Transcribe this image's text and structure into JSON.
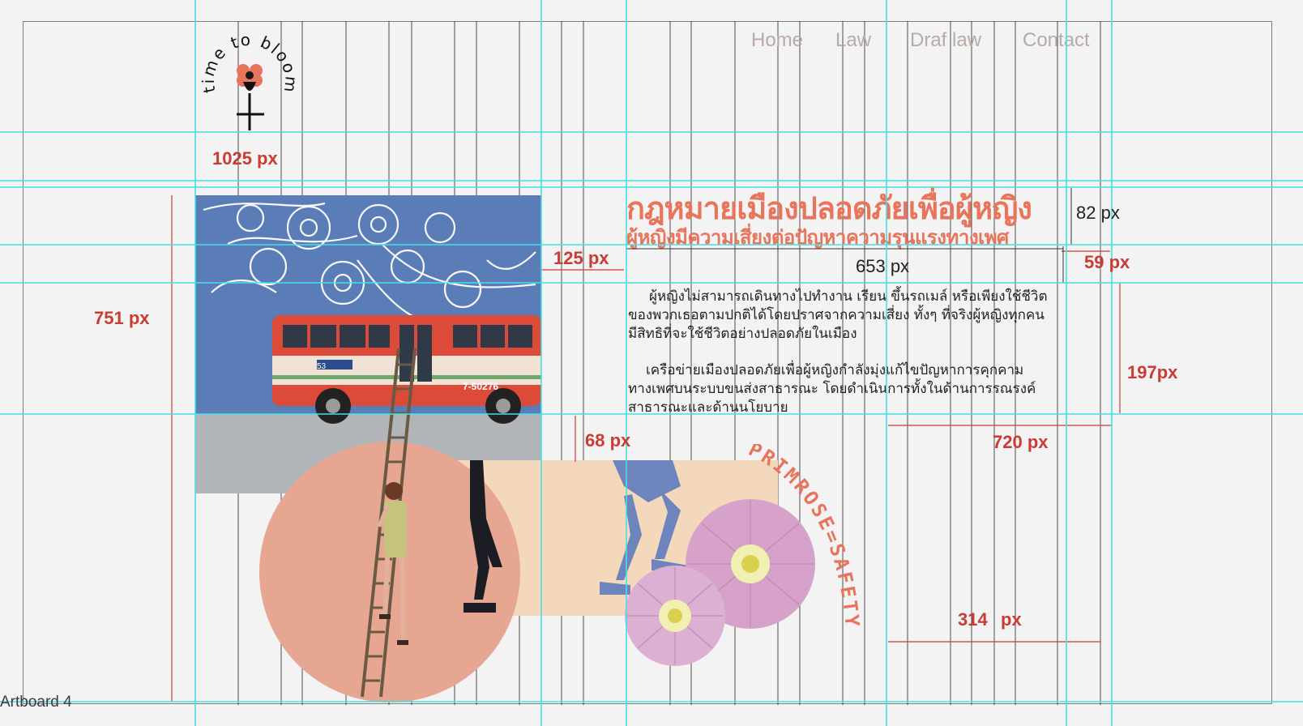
{
  "artboard": {
    "label": "Artboard 4"
  },
  "nav": {
    "items": [
      {
        "label": "Home"
      },
      {
        "label": "Law"
      },
      {
        "label": "Draf law"
      },
      {
        "label": "Contact"
      }
    ]
  },
  "logo": {
    "text": "time to bloom"
  },
  "content": {
    "title": "กฎหมายเมืองปลอดภัยเพื่อผู้หญิง",
    "subtitle": "ผู้หญิงมีความเสี่ยงต่อปัญหาความรุนแรงทางเพศ",
    "paragraph1": [
      "ผู้หญิงไม่สามารถเดินทางไปทำงาน เรียน ขึ้นรถเมล์ หรือเพียงใช้ชีวิต",
      "ของพวกเธอตามปกติได้โดยปราศจากความเสี่ยง ทั้งๆ ที่จริงผู้หญิงทุกคน",
      "มีสิทธิที่จะใช้ชีวิตอย่างปลอดภัยในเมือง"
    ],
    "paragraph2": [
      "เครือข่ายเมืองปลอดภัยเพื่อผู้หญิงกำลังมุ่งแก้ไขปัญหาการคุกคาม",
      "ทางเพศบนระบบขนส่งสาธารณะ โดยดำเนินการทั้งในด้านการรณรงค์",
      "สาธารณะและด้านนโยบาย"
    ]
  },
  "measurements": {
    "m1025": "1025 px",
    "m751": "751 px",
    "m125": "125 px",
    "m653": "653 px",
    "m82": "82 px",
    "m59": "59 px",
    "m197": "197px",
    "m68": "68 px",
    "m720": "720 px",
    "m314": "314",
    "m314unit": "px"
  },
  "art": {
    "primrose_text": "PRIMROSE=SAFETY",
    "bus_number": "53",
    "bus_plate": "7-50276"
  },
  "colors": {
    "accent": "#e9745c",
    "measure": "#c93c34",
    "guide": "#45e0e6",
    "circle": "#e6a692",
    "peach": "#f3d8bc",
    "sky": "#5b7db7",
    "bus_red": "#dc4a38"
  }
}
